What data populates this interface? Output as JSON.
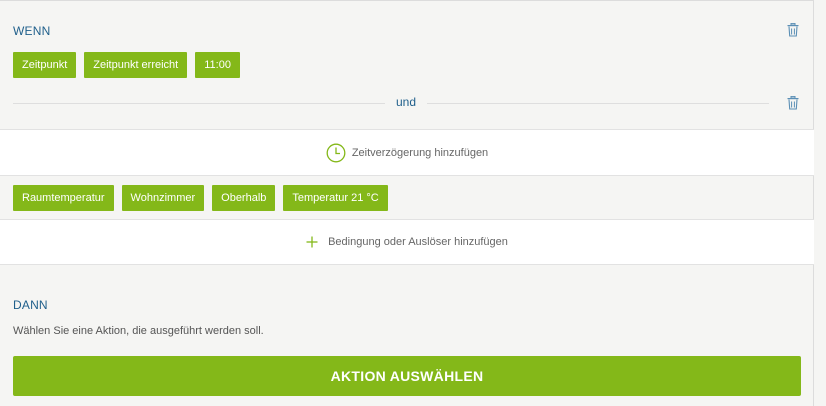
{
  "wenn": {
    "title": "WENN",
    "trigger_chips": [
      "Zeitpunkt",
      "Zeitpunkt erreicht",
      "11:00"
    ]
  },
  "connector": {
    "label": "und"
  },
  "delay": {
    "label": "Zeitverzögerung hinzufügen",
    "icon": "clock-icon"
  },
  "condition_chips": [
    "Raumtemperatur",
    "Wohnzimmer",
    "Oberhalb",
    "Temperatur 21 °C"
  ],
  "add_condition": {
    "label": "Bedingung oder Auslöser hinzufügen",
    "icon": "plus-icon"
  },
  "dann": {
    "title": "DANN",
    "hint": "Wählen Sie eine Aktion, die ausgeführt werden soll.",
    "button_label": "AKTION AUSWÄHLEN"
  },
  "colors": {
    "accent": "#84b819",
    "title_blue": "#1f5f8b",
    "icon_blue": "#5b8fb5"
  }
}
